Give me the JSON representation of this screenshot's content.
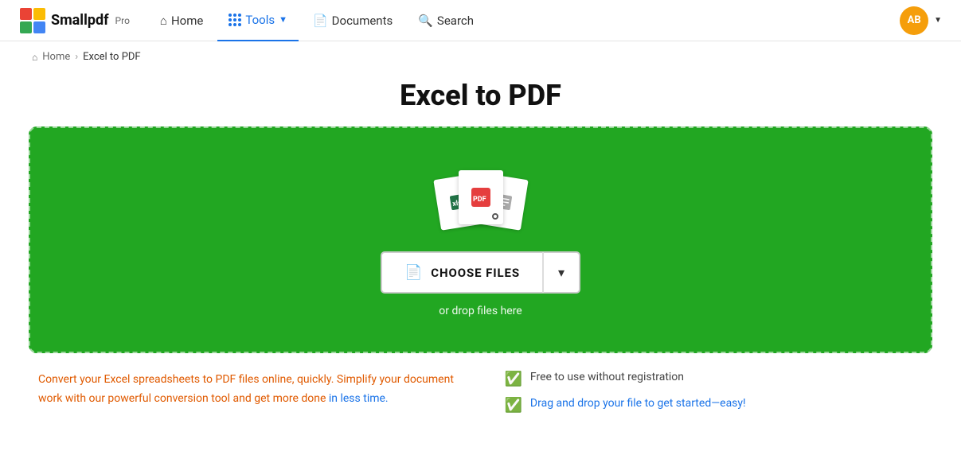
{
  "brand": {
    "name": "Smallpdf",
    "pro_label": "Pro",
    "logo_colors": [
      "#ea4335",
      "#fbbc04",
      "#34a853",
      "#4285f4"
    ]
  },
  "nav": {
    "home_label": "Home",
    "tools_label": "Tools",
    "documents_label": "Documents",
    "search_label": "Search",
    "avatar_initials": "AB"
  },
  "breadcrumb": {
    "home": "Home",
    "current": "Excel to PDF"
  },
  "page": {
    "title": "Excel to PDF"
  },
  "dropzone": {
    "choose_files_label": "CHOOSE FILES",
    "drop_text": "or drop files here"
  },
  "info": {
    "left_text_part1": "Convert your Excel spreadsheets to PDF files online, quickly. Simplify your document work with our powerful conversion tool and get more done ",
    "left_text_highlight": "in less time.",
    "right_items": [
      "Free to use without registration",
      "Drag and drop your file to get started—easy!"
    ]
  }
}
